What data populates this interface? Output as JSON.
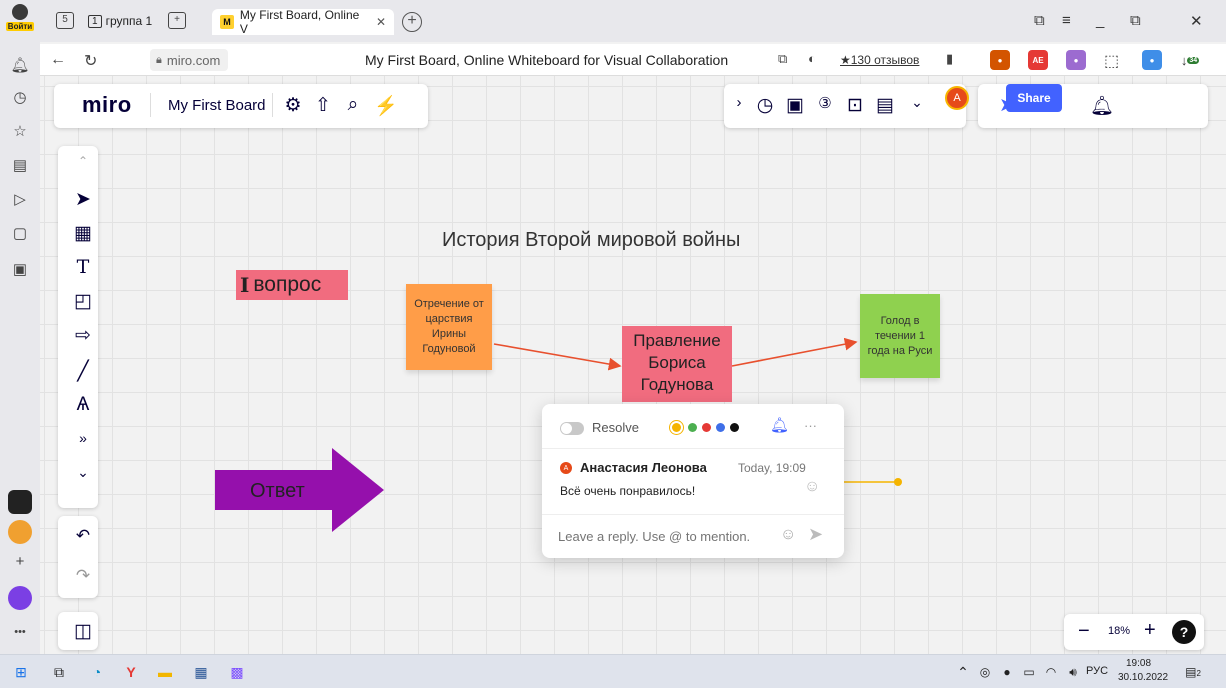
{
  "browser": {
    "login_label": "Войти",
    "tab_count": "5",
    "group_tab_label": "группа 1",
    "group_tab_number": "1",
    "active_tab_title": "My First Board, Online V",
    "url": "miro.com",
    "page_title": "My First Board, Online Whiteboard for Visual Collaboration",
    "reviews": "★130 отзывов",
    "downloads_badge": "34"
  },
  "miro": {
    "logo": "miro",
    "board_name": "My First Board",
    "share_label": "Share",
    "avatar_letter": "A",
    "zoom": "18%",
    "help": "?",
    "colors": {
      "accent": "#4262ff",
      "pink": "#f16c7f",
      "orange": "#ff9d48",
      "green": "#8fd14f",
      "purple": "#9510ac"
    }
  },
  "canvas": {
    "title": "История Второй мировой войны",
    "question_bold": "I",
    "question_text": "вопрос",
    "sticky_orange": "Отречение от царствия Ирины Годуновой",
    "box_pink": "Правление Бориса Годунова",
    "sticky_green": "Голод в течении 1 года на Руси",
    "arrow_label": "Ответ"
  },
  "comment": {
    "resolve_label": "Resolve",
    "more": "···",
    "author_initial": "A",
    "author": "Анастасия Леонова",
    "time": "Today, 19:09",
    "text": "Всё очень понравилось!",
    "reply_placeholder": "Leave a reply. Use @ to mention."
  },
  "taskbar": {
    "lang": "РУС",
    "time": "19:08",
    "date": "30.10.2022",
    "notifications": "2"
  }
}
